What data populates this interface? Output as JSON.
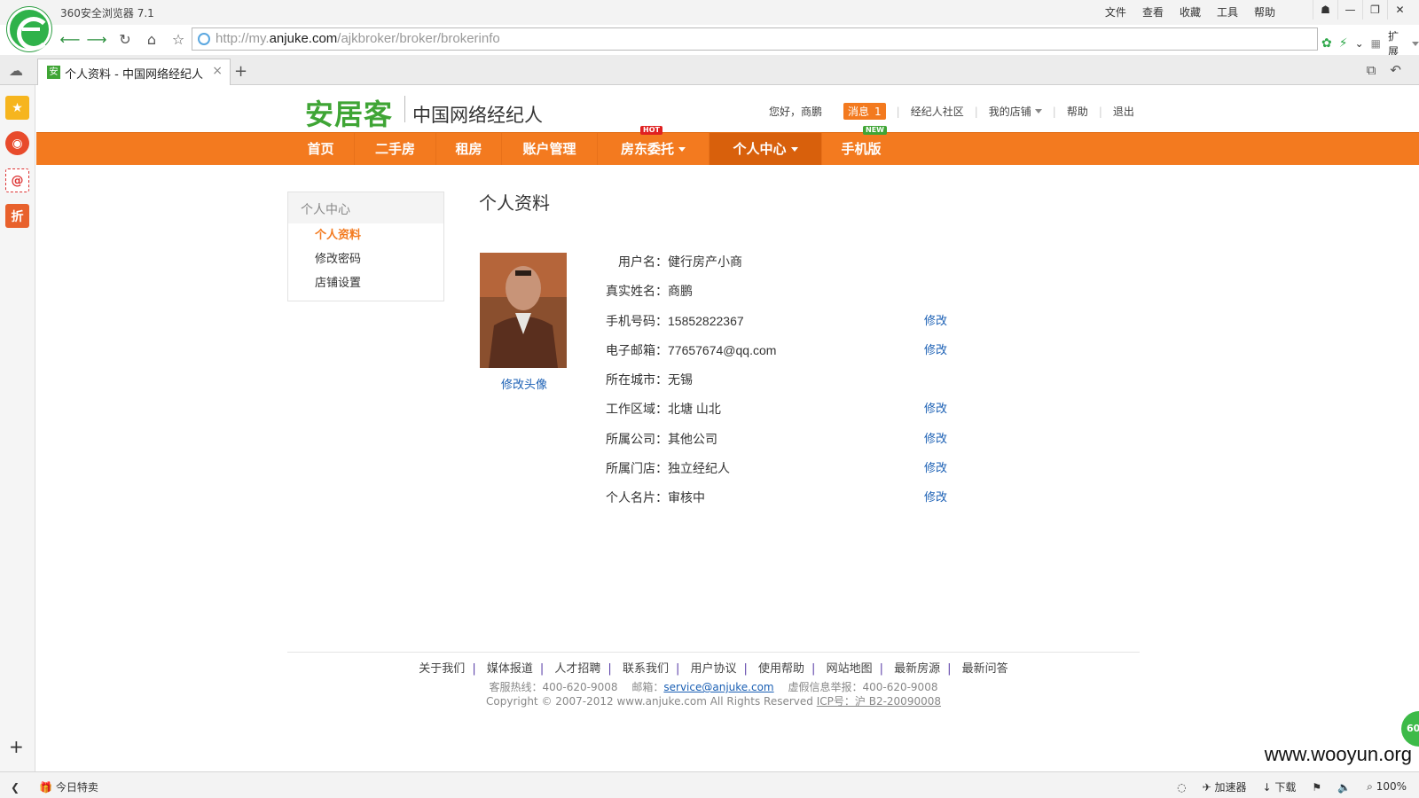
{
  "browser": {
    "title": "360安全浏览器 7.1",
    "menu": [
      "文件",
      "查看",
      "收藏",
      "工具",
      "帮助"
    ],
    "url_prefix": "http://my.",
    "url_host": "anjuke.com",
    "url_path": "/ajkbroker/broker/brokerinfo",
    "extend_label": "扩展",
    "tab_title": "个人资料 - 中国网络经纪人",
    "tab_favicon": "安",
    "status_left": "今日特卖",
    "status_accelerator": "加速器",
    "status_download": "下载",
    "zoom": "100%",
    "watermark": "www.wooyun.org",
    "badge": "60"
  },
  "site": {
    "logo": "安居客",
    "subtitle": "中国网络经纪人",
    "greeting": "您好，商鹏",
    "message_label": "消息",
    "message_count": "1",
    "community": "经纪人社区",
    "my_shop": "我的店铺",
    "help": "帮助",
    "logout": "退出"
  },
  "nav": {
    "items": [
      {
        "label": "首页"
      },
      {
        "label": "二手房"
      },
      {
        "label": "租房"
      },
      {
        "label": "账户管理"
      },
      {
        "label": "房东委托",
        "tag": "HOT"
      },
      {
        "label": "个人中心"
      },
      {
        "label": "手机版",
        "tag": "NEW"
      }
    ]
  },
  "leftnav": {
    "title": "个人中心",
    "items": [
      "个人资料",
      "修改密码",
      "店铺设置"
    ]
  },
  "main": {
    "title": "个人资料",
    "change_avatar": "修改头像",
    "edit_label": "修改",
    "rows": [
      {
        "label": "用户名：",
        "value": "健行房产小商"
      },
      {
        "label": "真实姓名：",
        "value": "商鹏"
      },
      {
        "label": "手机号码：",
        "value": "15852822367"
      },
      {
        "label": "电子邮箱：",
        "value": "77657674@qq.com"
      },
      {
        "label": "所在城市：",
        "value": "无锡"
      },
      {
        "label": "工作区域：",
        "value": "北塘 山北"
      },
      {
        "label": "所属公司：",
        "value": "其他公司"
      },
      {
        "label": "所属门店：",
        "value": "独立经纪人"
      },
      {
        "label": "个人名片：",
        "value": "审核中"
      }
    ]
  },
  "footer": {
    "links": [
      "关于我们",
      "媒体报道",
      "人才招聘",
      "联系我们",
      "用户协议",
      "使用帮助",
      "网站地图",
      "最新房源",
      "最新问答"
    ],
    "hotline": "客服热线：400-620-9008",
    "email_label": "邮箱：",
    "email": "service@anjuke.com",
    "report": "虚假信息举报：400-620-9008",
    "copyright": "Copyright © 2007-2012 www.anjuke.com All Rights Reserved",
    "icp": "ICP号：沪 B2-20090008"
  },
  "colors": {
    "brand_green": "#3fa535",
    "nav_orange": "#f37a1f",
    "link_blue": "#1a5fb4"
  }
}
